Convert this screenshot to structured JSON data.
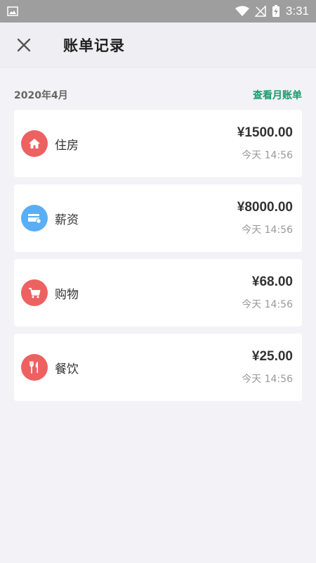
{
  "status_bar": {
    "time": "3:31"
  },
  "header": {
    "title": "账单记录",
    "close_icon": "close-icon"
  },
  "section": {
    "month": "2020年4月",
    "view_month_bill": "查看月账单",
    "link_color": "#1a9a6e"
  },
  "records": [
    {
      "category": "住房",
      "amount": "¥1500.00",
      "time": "今天 14:56",
      "icon": "house-icon",
      "icon_color": "#ee6161"
    },
    {
      "category": "薪资",
      "amount": "¥8000.00",
      "time": "今天 14:56",
      "icon": "salary-card-icon",
      "icon_color": "#5aaef5"
    },
    {
      "category": "购物",
      "amount": "¥68.00",
      "time": "今天 14:56",
      "icon": "shopping-cart-icon",
      "icon_color": "#ee6161"
    },
    {
      "category": "餐饮",
      "amount": "¥25.00",
      "time": "今天 14:56",
      "icon": "fork-knife-icon",
      "icon_color": "#ee6161"
    }
  ]
}
